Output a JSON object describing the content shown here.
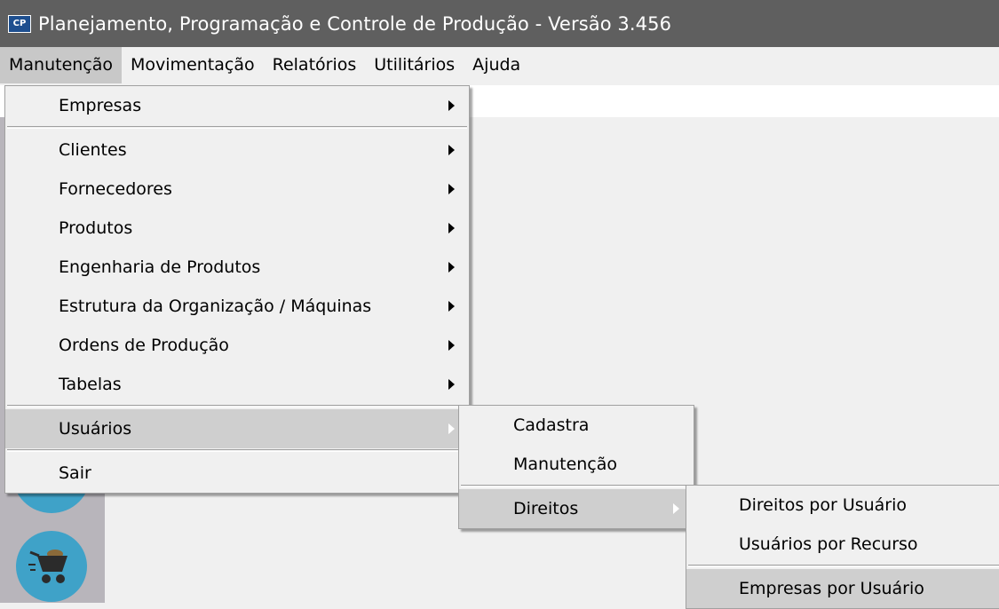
{
  "window": {
    "app_icon_text": "CP",
    "title": "Planejamento, Programação e Controle de Produção - Versão 3.456"
  },
  "menubar": {
    "items": [
      "Manutenção",
      "Movimentação",
      "Relatórios",
      "Utilitários",
      "Ajuda"
    ],
    "active": "Manutenção"
  },
  "menu_manutencao": {
    "items": [
      "Empresas",
      "Clientes",
      "Fornecedores",
      "Produtos",
      "Engenharia de Produtos",
      "Estrutura da Organização / Máquinas",
      "Ordens de Produção",
      "Tabelas",
      "Usuários",
      "Sair"
    ],
    "highlighted": "Usuários"
  },
  "submenu_usuarios": {
    "items": [
      "Cadastra",
      "Manutenção",
      "Direitos"
    ],
    "highlighted": "Direitos"
  },
  "submenu_direitos": {
    "items": [
      "Direitos por Usuário",
      "Usuários por Recurso",
      "Empresas por Usuário"
    ],
    "highlighted": "Empresas por Usuário"
  },
  "sidebar": {
    "icons": [
      "round-icon-button",
      "wheelbarrow-icon"
    ]
  },
  "colors": {
    "titlebar": "#5f5f5f",
    "menu_background": "#f0f0f0",
    "highlight": "#cfcfcf",
    "sidebar": "#b8b5bb",
    "icon_blue": "#3fa2c8"
  }
}
